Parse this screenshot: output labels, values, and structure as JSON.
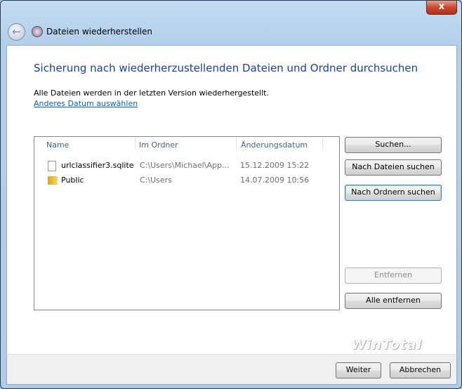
{
  "window": {
    "title": "Dateien wiederherstellen",
    "close_label": "x"
  },
  "heading": "Sicherung nach wiederherzustellenden Dateien und Ordner durchsuchen",
  "info": "Alle Dateien werden in der letzten Version wiederhergestellt.",
  "link": "Anderes Datum auswählen",
  "list": {
    "columns": [
      "Name",
      "Im Ordner",
      "Änderungsdatum"
    ],
    "rows": [
      {
        "name": "urlclassifier3.sqlite",
        "folder": "C:\\Users\\Michael\\App...",
        "date": "15.12.2009 15:22",
        "icon": "file-icon"
      },
      {
        "name": "Public",
        "folder": "C:\\Users",
        "date": "14.07.2009 10:56",
        "icon": "folder-icon"
      }
    ]
  },
  "buttons": {
    "search": "Suchen...",
    "search_files": "Nach Dateien suchen",
    "search_folders": "Nach Ordnern suchen",
    "remove": "Entfernen",
    "remove_all": "Alle entfernen",
    "next": "Weiter",
    "cancel": "Abbrechen"
  },
  "watermark": "WinTotal"
}
